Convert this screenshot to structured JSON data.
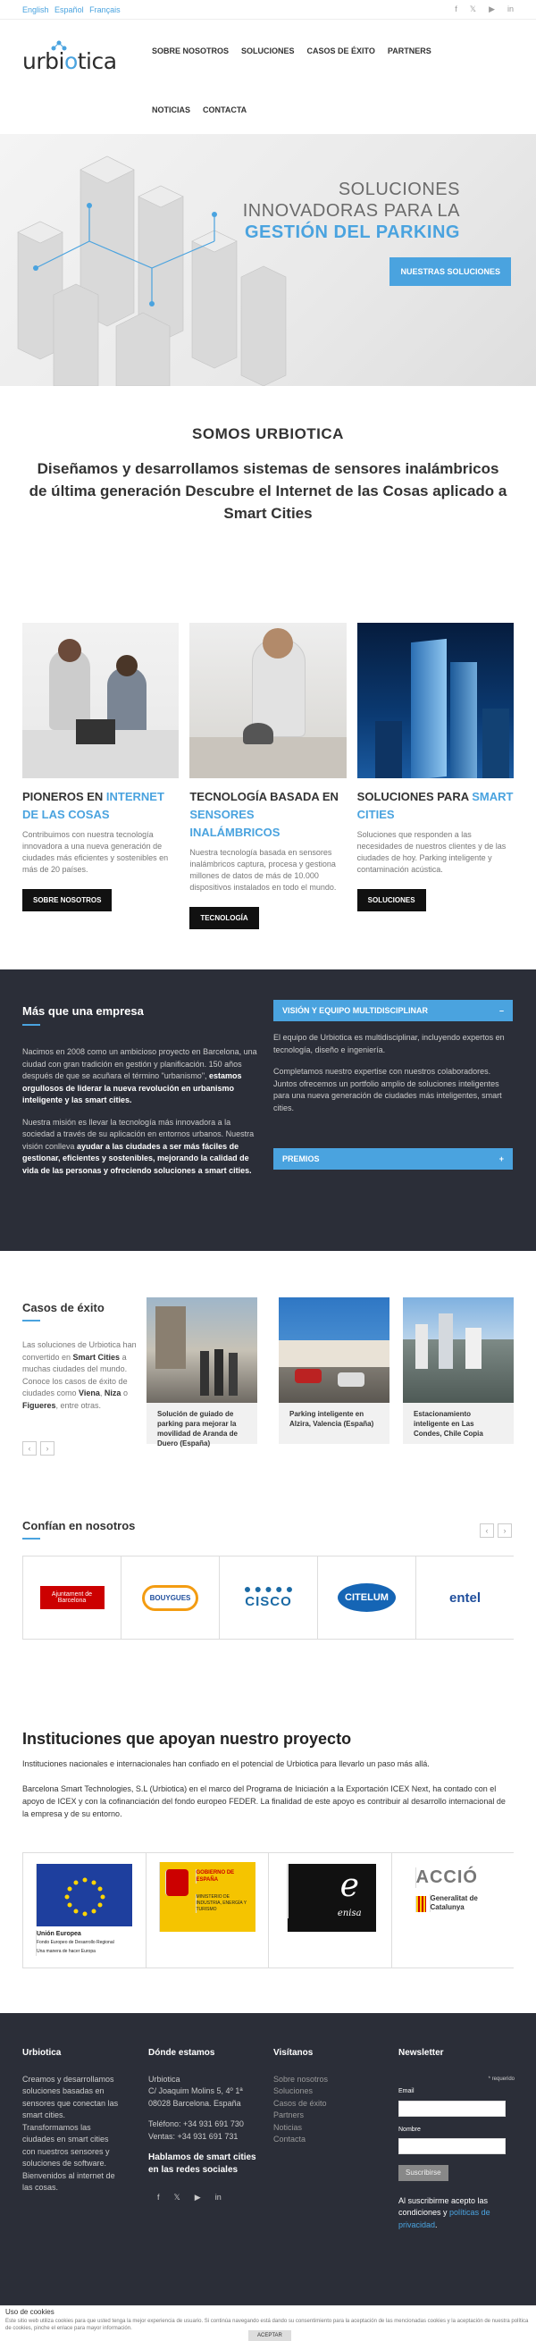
{
  "topbar": {
    "languages": [
      "English",
      "Español",
      "Français"
    ],
    "social": [
      "facebook-icon",
      "twitter-icon",
      "youtube-icon",
      "linkedin-icon"
    ]
  },
  "logo": {
    "text_a": "urbi",
    "text_b": "o",
    "text_c": "tica"
  },
  "nav": [
    "SOBRE NOSOTROS",
    "SOLUCIONES",
    "CASOS DE ÉXITO",
    "PARTNERS",
    "NOTICIAS",
    "CONTACTA"
  ],
  "hero": {
    "line1": "SOLUCIONES",
    "line2": "INNOVADORAS PARA LA",
    "line3": "GESTIÓN DEL PARKING",
    "button": "NUESTRAS SOLUCIONES"
  },
  "somos": {
    "title": "SOMOS URBIOTICA",
    "subtitle": "Diseñamos y desarrollamos sistemas de sensores inalámbricos de última generación  Descubre el Internet de las Cosas aplicado a Smart Cities"
  },
  "cards": [
    {
      "title_a": "PIONEROS EN ",
      "title_b": "INTERNET DE LAS COSAS",
      "text": "Contribuimos con nuestra tecnología innovadora a una nueva generación de ciudades más eficientes y sostenibles en más de 20 países.",
      "button": "SOBRE NOSOTROS"
    },
    {
      "title_a": "TECNOLOGÍA BASADA EN ",
      "title_b": "SENSORES INALÁMBRICOS",
      "text": "Nuestra tecnología basada en sensores inalámbricos captura, procesa y gestiona millones de datos de más de 10.000 dispositivos instalados en todo el mundo.",
      "button": "TECNOLOGÍA"
    },
    {
      "title_a": "SOLUCIONES PARA ",
      "title_b": "SMART CITIES",
      "text": "Soluciones que responden a las necesidades de nuestros clientes y de las ciudades de hoy. Parking inteligente y contaminación acústica.",
      "button": "SOLUCIONES"
    }
  ],
  "empresa": {
    "title": "Más que una empresa",
    "p1_a": "Nacimos en 2008 como un ambicioso proyecto en Barcelona, una ciudad con gran tradición en gestión y planificación. 150 años después de que se acuñara el término \"urbanismo\", ",
    "p1_b": "estamos orgullosos de liderar la nueva revolución en urbanismo inteligente y las smart cities.",
    "p2_a": "Nuestra misión es llevar la tecnología más innovadora a la sociedad a través de su aplicación en entornos urbanos. Nuestra visión conlleva ",
    "p2_b": "ayudar a las ciudades a ser más fáciles de gestionar, eficientes y sostenibles, mejorando la calidad de vida de las personas y ofreciendo soluciones a smart cities.",
    "acc1": "VISIÓN Y EQUIPO MULTIDISCIPLINAR",
    "acc1_sign": "–",
    "r1": "El equipo de Urbiotica es multidisciplinar, incluyendo expertos en tecnología, diseño e ingeniería.",
    "r2": "Completamos nuestro expertise con nuestros colaboradores. Juntos ofrecemos un portfolio amplio de soluciones inteligentes para una nueva generación de ciudades más inteligentes, smart cities.",
    "acc2": "PREMIOS",
    "acc2_sign": "+"
  },
  "casos": {
    "title": "Casos de éxito",
    "t1": "Las soluciones de Urbiotica han convertido en ",
    "t2": "Smart Cities",
    "t3": " a muchas ciudades del mundo. Conoce los casos de éxito de ciudades como ",
    "t4": "Viena",
    "t5": ", ",
    "t6": "Niza",
    "t7": " o ",
    "t8": "Figueres",
    "t9": ", entre otras.",
    "items": [
      "Solución de guiado de parking para mejorar la movilidad de Aranda de Duero (España)",
      "Parking inteligente en Alzira, Valencia (España)",
      "Estacionamiento inteligente en Las Condes, Chile Copia"
    ]
  },
  "confian": {
    "title": "Confían en nosotros",
    "logos": [
      "Ajuntament de Barcelona",
      "BOUYGUES",
      "CISCO",
      "CITELUM",
      "entel"
    ]
  },
  "instituciones": {
    "title": "Instituciones que apoyan nuestro proyecto",
    "p1": "Instituciones nacionales e internacionales han confiado en el potencial de Urbiotica para llevarlo un paso más allá.",
    "p2": "Barcelona Smart Technologies, S.L (Urbiotica) en el marco del Programa de Iniciación a la Exportación ICEX Next, ha contado con el apoyo de ICEX y con la cofinanciación del fondo europeo FEDER. La finalidad de este apoyo es contribuir al desarrollo internacional de la empresa y de su entorno.",
    "eu_a": "Unión Europea",
    "eu_b": "Fondo Europeo de Desarrollo Regional",
    "eu_c": "Una manera de hacer Europa",
    "gov_a": "GOBIERNO DE ESPAÑA",
    "gov_b": "MINISTERIO DE INDUSTRIA, ENERGÍA Y TURISMO",
    "enisa": "enisa",
    "accio": "ACCIÓ",
    "gencat": "Generalitat de Catalunya"
  },
  "footer": {
    "c1_title": "Urbiotica",
    "c1_text": "Creamos y desarrollamos soluciones basadas en sensores que conectan las smart cities. Transformamos las ciudades en smart cities con nuestros sensores y soluciones de software. Bienvenidos al internet de las cosas.",
    "c2_title": "Dónde estamos",
    "c2_l1": "Urbiotica",
    "c2_l2": "C/ Joaquim Molins 5, 4º 1ª",
    "c2_l3": "08028 Barcelona. España",
    "c2_l4": "Teléfono: +34 931 691 730",
    "c2_l5": "Ventas: +34 931 691 731",
    "c2_sub": "Hablamos de smart cities en las redes sociales",
    "c3_title": "Visítanos",
    "c3_links": [
      "Sobre nosotros",
      "Soluciones",
      "Casos de éxito",
      "Partners",
      "Noticias",
      "Contacta"
    ],
    "c4_title": "Newsletter",
    "required": "* requerido",
    "email": "Email",
    "nombre": "Nombre",
    "subscribe": "Suscribirse",
    "legal_a": "Al suscribirme acepto las condiciones y ",
    "legal_b": "políticas de privacidad",
    "legal_c": "."
  },
  "cookies": {
    "title": "Uso de cookies",
    "text": "Este sitio web utiliza cookies para que usted tenga la mejor experiencia de usuario. Si continúa navegando está dando su consentimiento para la aceptación de las mencionadas cookies y la aceptación de nuestra política de cookies, pinche el enlace para mayor información.",
    "accept": "ACEPTAR"
  },
  "colors": {
    "accent": "#4aa3df",
    "dark": "#2b2e38"
  }
}
